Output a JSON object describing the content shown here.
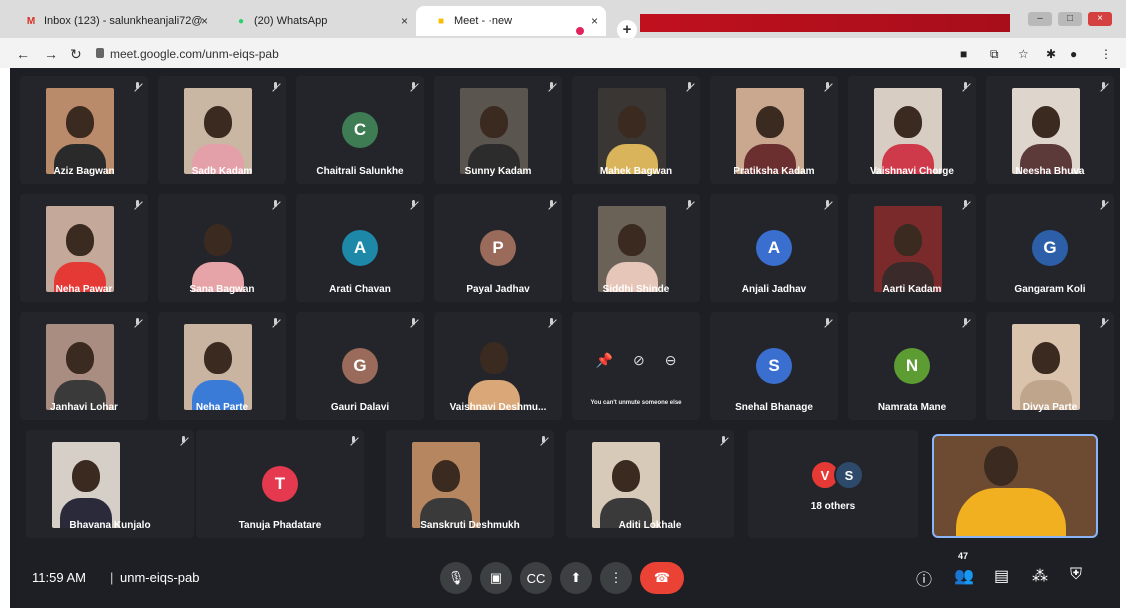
{
  "browser": {
    "tabs": [
      {
        "label": "Inbox (123) - salunkheanjali72@",
        "icon": "gmail-icon",
        "color": "#d93025"
      },
      {
        "label": "(20) WhatsApp",
        "icon": "whatsapp-icon",
        "color": "#25d366"
      },
      {
        "label": "Meet - ·new",
        "icon": "meet-icon",
        "color": "#fbbc04"
      }
    ],
    "url": "meet.google.com/unm-eiqs-pab"
  },
  "participants": [
    {
      "name": "Aziz Bagwan",
      "kind": "video",
      "bg": "#b98b6a",
      "shirt": "#2a2a2a"
    },
    {
      "name": "Sadb Kadam",
      "kind": "video",
      "bg": "#c9b7a3",
      "shirt": "#e4a0a8"
    },
    {
      "name": "Chaitrali Salunkhe",
      "kind": "avatar",
      "initial": "C",
      "color": "#3e7d54"
    },
    {
      "name": "Sunny Kadam",
      "kind": "video",
      "bg": "#5b5550",
      "shirt": "#2c2c2c"
    },
    {
      "name": "Mahek Bagwan",
      "kind": "video",
      "bg": "#3a3633",
      "shirt": "#d9b45a"
    },
    {
      "name": "Pratiksha Kadam",
      "kind": "video",
      "bg": "#caa88f",
      "shirt": "#6b2f2f"
    },
    {
      "name": "Vaishnavi Chorge",
      "kind": "video",
      "bg": "#d8cdc3",
      "shirt": "#cf3a4b"
    },
    {
      "name": "Neesha Bhuva",
      "kind": "video",
      "bg": "#ded6cc",
      "shirt": "#5d3a3a"
    },
    {
      "name": "Neha Pawar",
      "kind": "video",
      "bg": "#c4a89a",
      "shirt": "#e53935"
    },
    {
      "name": "Sana Bagwan",
      "kind": "video",
      "bg": "#23252b",
      "shirt": "#e7a4a8"
    },
    {
      "name": "Arati Chavan",
      "kind": "avatar",
      "initial": "A",
      "color": "#1e88a8"
    },
    {
      "name": "Payal Jadhav",
      "kind": "avatar",
      "initial": "P",
      "color": "#9a6a5a"
    },
    {
      "name": "Siddhi Shinde",
      "kind": "video",
      "bg": "#6a6257",
      "shirt": "#e6c6b8"
    },
    {
      "name": "Anjali Jadhav",
      "kind": "avatar",
      "initial": "A",
      "color": "#3a6fd0"
    },
    {
      "name": "Aarti Kadam",
      "kind": "video",
      "bg": "#7a2a2a",
      "shirt": "#3a2a2a"
    },
    {
      "name": "Gangaram Koli",
      "kind": "avatar",
      "initial": "G",
      "color": "#2d5fa8"
    },
    {
      "name": "Janhavi Lohar",
      "kind": "video",
      "bg": "#a88d80",
      "shirt": "#3a3a3a"
    },
    {
      "name": "Neha Parte",
      "kind": "video",
      "bg": "#c8b4a0",
      "shirt": "#3b7bd8"
    },
    {
      "name": "Gauri Dalavi",
      "kind": "avatar",
      "initial": "G",
      "color": "#9a6a5a"
    },
    {
      "name": "Vaishnavi Deshmu...",
      "kind": "video",
      "bg": "#23252b",
      "shirt": "#d9a778"
    },
    {
      "name": "Snehal Bhanage",
      "kind": "avatar",
      "initial": "S",
      "color": "#3a6fd0"
    },
    {
      "name": "Namrata Mane",
      "kind": "avatar",
      "initial": "N",
      "color": "#5c9c32"
    },
    {
      "name": "Divya Parte",
      "kind": "video",
      "bg": "#d9c3ac",
      "shirt": "#bfa58c"
    },
    {
      "name": "Bhavana Kunjalo",
      "kind": "video",
      "bg": "#d6cfc8",
      "shirt": "#2a2a3a"
    },
    {
      "name": "Tanuja Phadatare",
      "kind": "avatar",
      "initial": "T",
      "color": "#e53950"
    },
    {
      "name": "Sanskruti Deshmukh",
      "kind": "video",
      "bg": "#b68660",
      "shirt": "#3a3a3a"
    },
    {
      "name": "Aditi Lokhale",
      "kind": "video",
      "bg": "#d8cab8",
      "shirt": "#3a3a3a"
    }
  ],
  "control_tile": {
    "message": "You can't unmute someone else"
  },
  "others": {
    "label": "18 others",
    "initials": [
      "V",
      "S"
    ],
    "colors": [
      "#e53935",
      "#2d4a6a"
    ]
  },
  "bottom": {
    "time": "11:59 AM",
    "separator": "|",
    "meeting_code": "unm-eiqs-pab",
    "participant_count": "47"
  }
}
